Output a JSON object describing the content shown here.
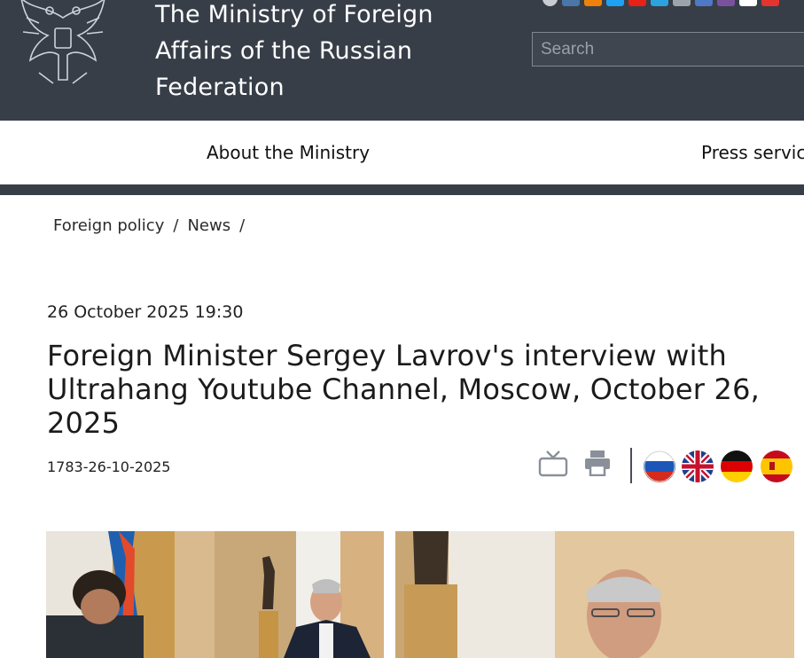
{
  "header": {
    "site_title": "The Ministry of Foreign Affairs of the Russian Federation",
    "emblem_icon": "double-headed-eagle-emblem-icon",
    "search_placeholder": "Search",
    "social_icons": [
      "info-icon",
      "vk-icon",
      "ok-icon",
      "twitter-icon",
      "youtube-icon",
      "telegram-icon",
      "rss-icon",
      "flickr-icon",
      "viber-icon",
      "tiktok-icon",
      "rutube-icon"
    ],
    "background": "#373e48"
  },
  "nav": {
    "items": [
      {
        "label": "About the Ministry"
      },
      {
        "label": "Press service"
      }
    ]
  },
  "breadcrumb": {
    "items": [
      "Foreign policy",
      "News"
    ],
    "separator": "/"
  },
  "article": {
    "date": "26 October 2025 19:30",
    "title": "Foreign Minister Sergey Lavrov's interview with Ultrahang Youtube Channel, Moscow, October 26, 2025",
    "doc_number": "1783-26-10-2025"
  },
  "tools": {
    "icons": [
      "tv-icon",
      "print-icon"
    ],
    "languages": [
      {
        "code": "ru",
        "icon": "russia-flag-icon"
      },
      {
        "code": "en",
        "icon": "uk-flag-icon"
      },
      {
        "code": "de",
        "icon": "germany-flag-icon"
      },
      {
        "code": "es",
        "icon": "spain-flag-icon"
      }
    ]
  },
  "photos": [
    "interview-photo-wide",
    "interview-photo-closeup"
  ]
}
